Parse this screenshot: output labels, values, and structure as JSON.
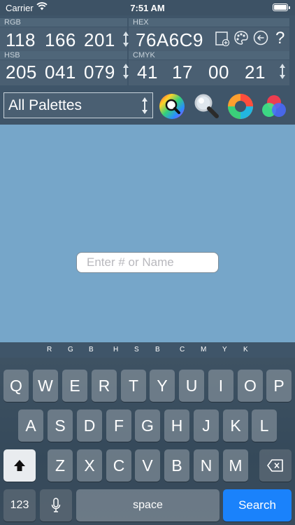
{
  "status_bar": {
    "carrier": "Carrier",
    "time": "7:51 AM"
  },
  "values": {
    "rgb": {
      "label": "RGB",
      "r": "118",
      "g": "166",
      "b": "201"
    },
    "hex": {
      "label": "HEX",
      "value": "76A6C9"
    },
    "hsb": {
      "label": "HSB",
      "h": "205",
      "s": "041",
      "b": "079"
    },
    "cmyk": {
      "label": "CMYK",
      "c": "41",
      "m": "17",
      "y": "00",
      "k": "21"
    },
    "help_label": "?"
  },
  "palette": {
    "selected": "All Palettes"
  },
  "swatch": {
    "color": "#76A6C9",
    "input_placeholder": "Enter # or Name"
  },
  "channels": [
    "R",
    "G",
    "B",
    "H",
    "S",
    "B",
    "C",
    "M",
    "Y",
    "K"
  ],
  "keyboard": {
    "row1": [
      "Q",
      "W",
      "E",
      "R",
      "T",
      "Y",
      "U",
      "I",
      "O",
      "P"
    ],
    "row2": [
      "A",
      "S",
      "D",
      "F",
      "G",
      "H",
      "J",
      "K",
      "L"
    ],
    "row3": [
      "Z",
      "X",
      "C",
      "V",
      "B",
      "N",
      "M"
    ],
    "numbers_label": "123",
    "space_label": "space",
    "search_label": "Search"
  },
  "icons": {
    "wifi": "wifi-icon",
    "battery": "battery-icon",
    "add_swatch": "add-swatch-icon",
    "palette": "palette-icon",
    "back": "back-arrow-icon",
    "color_search": "color-wheel-search-icon",
    "magnifier": "magnifier-icon",
    "aperture": "aperture-icon",
    "rgb_mix": "rgb-mix-icon",
    "shift": "shift-icon",
    "delete": "delete-icon",
    "mic": "microphone-icon"
  },
  "colors": {
    "accent": "#1A82FB",
    "background": "#3F5569"
  }
}
